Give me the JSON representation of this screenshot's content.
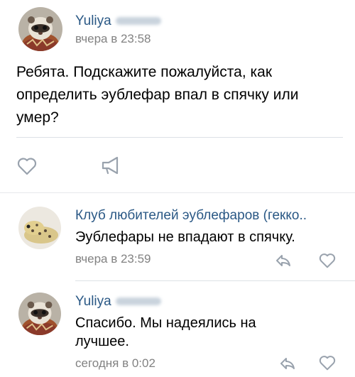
{
  "post": {
    "author": "Yuliya",
    "time": "вчера в 23:58",
    "text": "Ребята. Подскажите пожалуйста, как определить эублефар впал в спячку или умер?"
  },
  "comments": [
    {
      "author": "Клуб любителей эублефаров (гекко..",
      "text": "Эублефары не впадают в спячку.",
      "time": "вчера в 23:59"
    },
    {
      "author": "Yuliya",
      "text": "Спасибо. Мы надеялись на лучшее.",
      "time": "сегодня в 0:02"
    }
  ],
  "colors": {
    "link": "#2a5885",
    "meta": "#828282",
    "icon": "#99a2ad",
    "divider": "#dce1e6"
  },
  "icons": {
    "like": "heart-icon",
    "share": "megaphone-icon",
    "reply": "reply-arrow-icon"
  }
}
